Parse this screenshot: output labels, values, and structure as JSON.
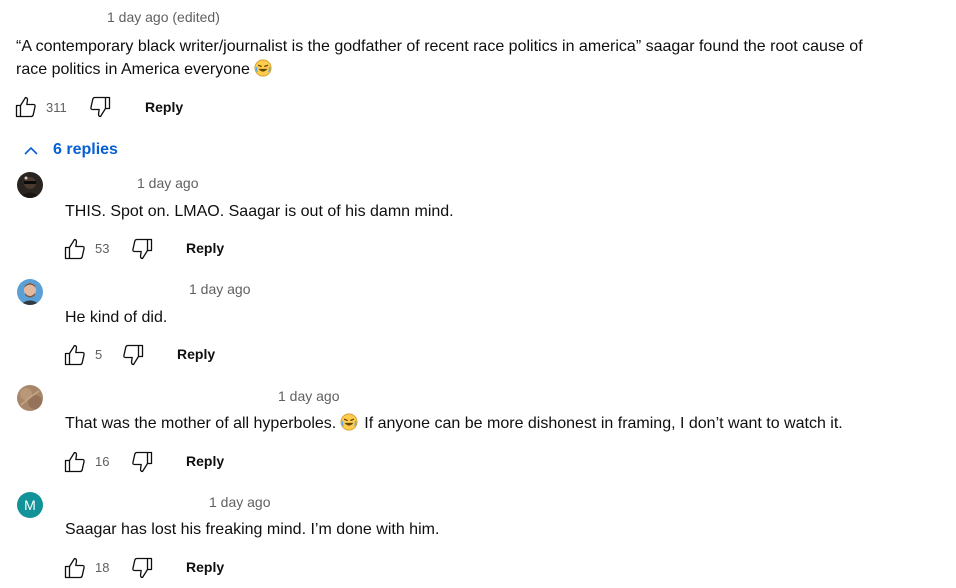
{
  "comment": {
    "timestamp": "1 day ago (edited)",
    "text_line1": "“A contemporary black writer/journalist is the godfather of recent race politics in america” saagar found the root cause of",
    "text_line2": "race politics in America everyone",
    "emoji": "laughing-emoji",
    "likes": "311",
    "reply_label": "Reply"
  },
  "replies_toggle": {
    "label": "6 replies",
    "expanded": true
  },
  "replies": [
    {
      "avatar": "dark-avatar",
      "timestamp": "1 day ago",
      "text": "THIS. Spot on. LMAO. Saagar is out of his damn mind.",
      "likes": "53",
      "reply_label": "Reply"
    },
    {
      "avatar": "man-avatar",
      "timestamp": "1 day ago",
      "text": "He kind of did.",
      "likes": "5",
      "reply_label": "Reply"
    },
    {
      "avatar": "brown-avatar",
      "timestamp": "1 day ago",
      "text_before_emoji": "That was the mother of all hyperboles.",
      "text_after_emoji": "If anyone can be more dishonest in framing, I don’t want to watch it.",
      "likes": "16",
      "reply_label": "Reply"
    },
    {
      "avatar_letter": "M",
      "avatar_color": "#12939a",
      "timestamp": "1 day ago",
      "text": "Saagar has lost his freaking mind. I’m done with him.",
      "likes": "18",
      "reply_label": "Reply"
    }
  ],
  "colors": {
    "link_blue": "#065fd4",
    "meta_gray": "#606060"
  }
}
